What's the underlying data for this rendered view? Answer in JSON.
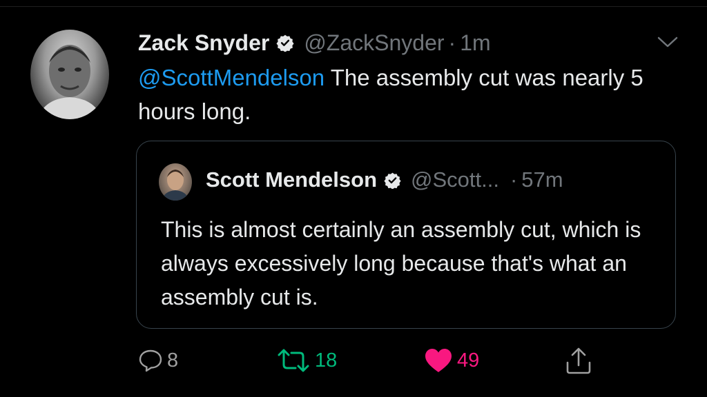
{
  "tweet": {
    "author_name": "Zack Snyder",
    "author_handle": "@ZackSnyder",
    "separator": "·",
    "time": "1m",
    "mention": "@ScottMendelson",
    "text": " The assembly cut was nearly 5 hours long."
  },
  "quoted_tweet": {
    "author_name": "Scott Mendelson",
    "author_handle": "@Scott...",
    "separator": "·",
    "time": "57m",
    "text": "This is almost certainly an assembly cut, which is always excessively long because that's what an assembly cut is."
  },
  "actions": {
    "replies": "8",
    "retweets": "18",
    "likes": "49"
  },
  "icons": {
    "verified": "verified-badge-icon",
    "menu": "chevron-down-icon",
    "reply": "reply-icon",
    "retweet": "retweet-icon",
    "like": "heart-icon",
    "share": "share-icon"
  },
  "colors": {
    "background": "#000000",
    "mention": "#1d9bf0",
    "retweet": "#00ba7c",
    "like": "#f91880",
    "muted": "#71767b"
  }
}
